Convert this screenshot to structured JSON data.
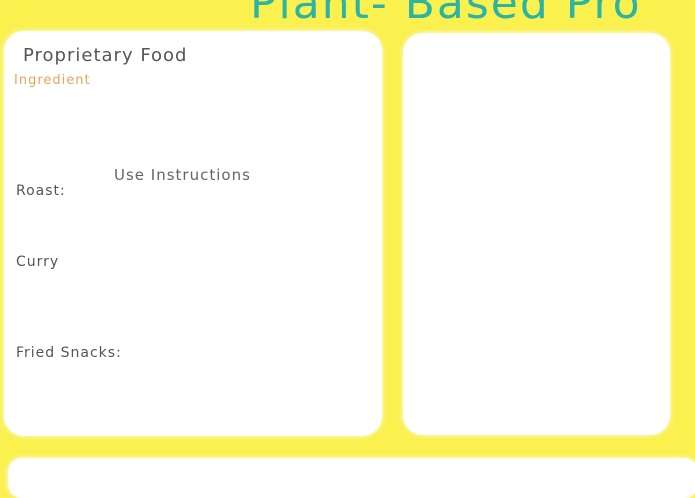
{
  "banner": {
    "title": "Plant- Based Pro"
  },
  "left_panel": {
    "food_title": "Proprietary Food",
    "ingredient_label": "Ingredient",
    "instructions_title": "Use Instructions",
    "methods": [
      {
        "label": "Roast:"
      },
      {
        "label": "Curry"
      },
      {
        "label": "Fried Snacks:"
      }
    ]
  },
  "colors": {
    "background": "#faf04e",
    "title_teal": "#2bb3a3",
    "label_orange": "#e8a45a",
    "panel": "#ffffff"
  }
}
